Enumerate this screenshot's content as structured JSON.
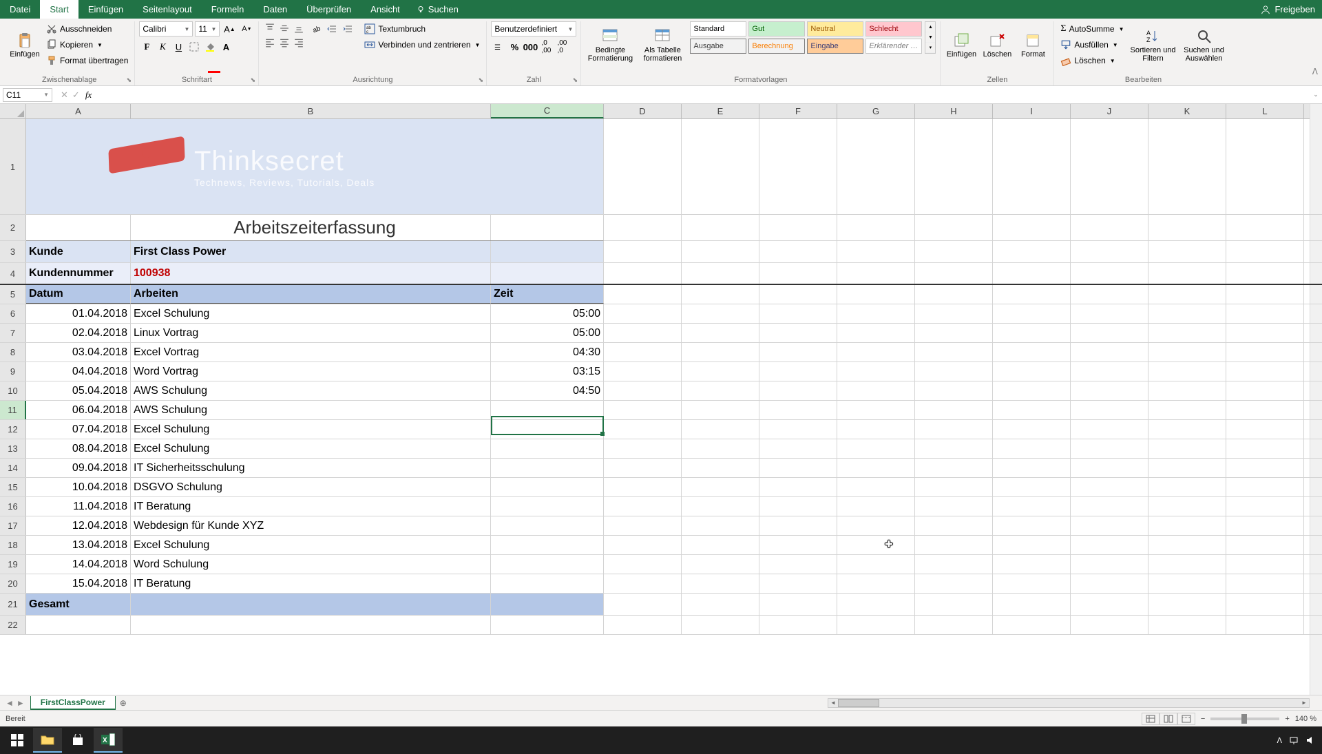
{
  "titlebar": {
    "file": "Datei",
    "tabs": [
      "Start",
      "Einfügen",
      "Seitenlayout",
      "Formeln",
      "Daten",
      "Überprüfen",
      "Ansicht"
    ],
    "active_tab": 0,
    "search": "Suchen",
    "share": "Freigeben"
  },
  "ribbon": {
    "clipboard": {
      "paste": "Einfügen",
      "cut": "Ausschneiden",
      "copy": "Kopieren",
      "formatpainter": "Format übertragen",
      "label": "Zwischenablage"
    },
    "font": {
      "name": "Calibri",
      "size": "11",
      "label": "Schriftart"
    },
    "align": {
      "wrap": "Textumbruch",
      "merge": "Verbinden und zentrieren",
      "label": "Ausrichtung"
    },
    "number": {
      "format": "Benutzerdefiniert",
      "label": "Zahl"
    },
    "styles": {
      "cond": "Bedingte\nFormatierung",
      "table": "Als Tabelle\nformatieren",
      "gallery": [
        {
          "t": "Standard",
          "bg": "#ffffff",
          "c": "#000"
        },
        {
          "t": "Gut",
          "bg": "#c6efce",
          "c": "#006100"
        },
        {
          "t": "Neutral",
          "bg": "#ffeb9c",
          "c": "#9c5700"
        },
        {
          "t": "Schlecht",
          "bg": "#ffc7ce",
          "c": "#9c0006"
        },
        {
          "t": "Ausgabe",
          "bg": "#f2f2f2",
          "c": "#3f3f3f"
        },
        {
          "t": "Berechnung",
          "bg": "#f2f2f2",
          "c": "#fa7d00"
        },
        {
          "t": "Eingabe",
          "bg": "#ffcc99",
          "c": "#3f3f76"
        },
        {
          "t": "Erklärender …",
          "bg": "#ffffff",
          "c": "#7f7f7f"
        }
      ],
      "label": "Formatvorlagen"
    },
    "cells": {
      "insert": "Einfügen",
      "delete": "Löschen",
      "format": "Format",
      "label": "Zellen"
    },
    "editing": {
      "sum": "AutoSumme",
      "fill": "Ausfüllen",
      "clear": "Löschen",
      "sort": "Sortieren und\nFiltern",
      "find": "Suchen und\nAuswählen",
      "label": "Bearbeiten"
    }
  },
  "namebox": "C11",
  "columns": [
    "A",
    "B",
    "C",
    "D",
    "E",
    "F",
    "G",
    "H",
    "I",
    "J",
    "K",
    "L"
  ],
  "logo": {
    "name": "Thinksecret",
    "tagline": "Technews, Reviews, Tutorials, Deals"
  },
  "sheet": {
    "title": "Arbeitszeiterfassung",
    "r3": {
      "a": "Kunde",
      "b": "First Class Power"
    },
    "r4": {
      "a": "Kundennummer",
      "b": "100938"
    },
    "r5": {
      "a": "Datum",
      "b": "Arbeiten",
      "c": "Zeit"
    },
    "data": [
      {
        "a": "01.04.2018",
        "b": "Excel Schulung",
        "c": "05:00"
      },
      {
        "a": "02.04.2018",
        "b": "Linux Vortrag",
        "c": "05:00"
      },
      {
        "a": "03.04.2018",
        "b": "Excel Vortrag",
        "c": "04:30"
      },
      {
        "a": "04.04.2018",
        "b": "Word Vortrag",
        "c": "03:15"
      },
      {
        "a": "05.04.2018",
        "b": "AWS Schulung",
        "c": "04:50"
      },
      {
        "a": "06.04.2018",
        "b": "AWS Schulung",
        "c": ""
      },
      {
        "a": "07.04.2018",
        "b": "Excel Schulung",
        "c": ""
      },
      {
        "a": "08.04.2018",
        "b": "Excel Schulung",
        "c": ""
      },
      {
        "a": "09.04.2018",
        "b": "IT Sicherheitsschulung",
        "c": ""
      },
      {
        "a": "10.04.2018",
        "b": "DSGVO Schulung",
        "c": ""
      },
      {
        "a": "11.04.2018",
        "b": "IT Beratung",
        "c": ""
      },
      {
        "a": "12.04.2018",
        "b": "Webdesign für Kunde XYZ",
        "c": ""
      },
      {
        "a": "13.04.2018",
        "b": "Excel Schulung",
        "c": ""
      },
      {
        "a": "14.04.2018",
        "b": "Word Schulung",
        "c": ""
      },
      {
        "a": "15.04.2018",
        "b": "IT Beratung",
        "c": ""
      }
    ],
    "gesamt": "Gesamt"
  },
  "sheet_tab": "FirstClassPower",
  "status": {
    "ready": "Bereit",
    "zoom": "140 %"
  }
}
